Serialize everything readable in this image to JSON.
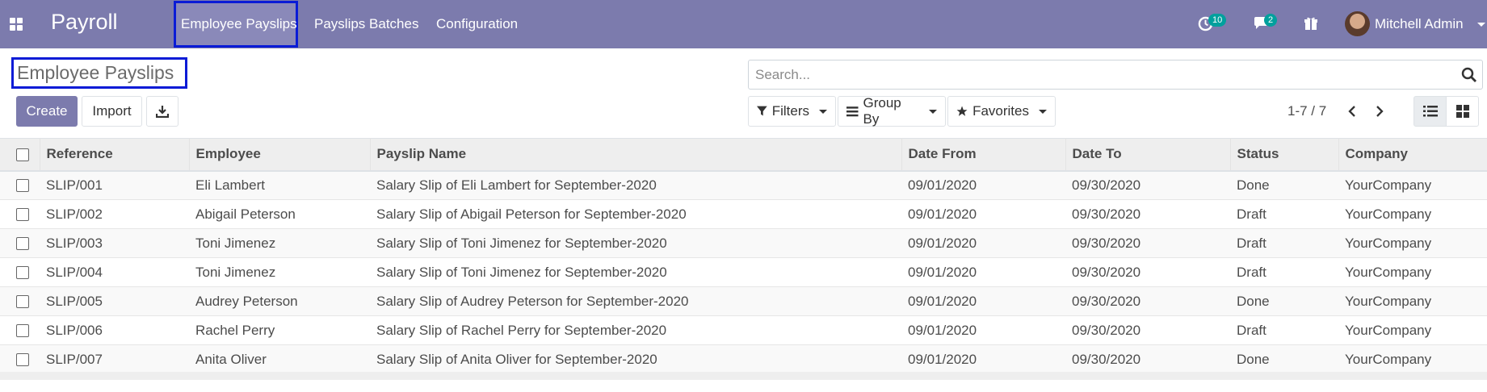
{
  "navbar": {
    "app_name": "Payroll",
    "menu": [
      "Employee Payslips",
      "Payslips Batches",
      "Configuration"
    ],
    "activity_count": "10",
    "message_count": "2",
    "user_name": "Mitchell Admin",
    "color": "#7c7bad"
  },
  "control_panel": {
    "title": "Employee Payslips",
    "create_label": "Create",
    "import_label": "Import",
    "search_placeholder": "Search...",
    "filters_label": "Filters",
    "group_by_label": "Group By",
    "favorites_label": "Favorites",
    "pager": "1-7 / 7"
  },
  "table": {
    "columns": [
      "Reference",
      "Employee",
      "Payslip Name",
      "Date From",
      "Date To",
      "Status",
      "Company"
    ],
    "rows": [
      [
        "SLIP/001",
        "Eli Lambert",
        "Salary Slip of Eli Lambert for September-2020",
        "09/01/2020",
        "09/30/2020",
        "Done",
        "YourCompany"
      ],
      [
        "SLIP/002",
        "Abigail Peterson",
        "Salary Slip of Abigail Peterson for September-2020",
        "09/01/2020",
        "09/30/2020",
        "Draft",
        "YourCompany"
      ],
      [
        "SLIP/003",
        "Toni Jimenez",
        "Salary Slip of Toni Jimenez for September-2020",
        "09/01/2020",
        "09/30/2020",
        "Draft",
        "YourCompany"
      ],
      [
        "SLIP/004",
        "Toni Jimenez",
        "Salary Slip of Toni Jimenez for September-2020",
        "09/01/2020",
        "09/30/2020",
        "Draft",
        "YourCompany"
      ],
      [
        "SLIP/005",
        "Audrey Peterson",
        "Salary Slip of Audrey Peterson for September-2020",
        "09/01/2020",
        "09/30/2020",
        "Done",
        "YourCompany"
      ],
      [
        "SLIP/006",
        "Rachel Perry",
        "Salary Slip of Rachel Perry for September-2020",
        "09/01/2020",
        "09/30/2020",
        "Draft",
        "YourCompany"
      ],
      [
        "SLIP/007",
        "Anita Oliver",
        "Salary Slip of Anita Oliver for September-2020",
        "09/01/2020",
        "09/30/2020",
        "Done",
        "YourCompany"
      ]
    ]
  }
}
